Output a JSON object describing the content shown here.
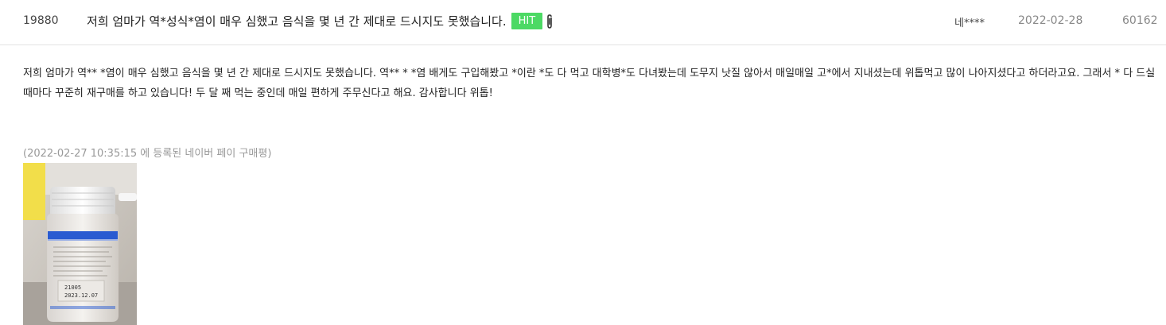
{
  "post": {
    "number": "19880",
    "title": "저희 엄마가 역*성식*염이 매우 심했고 음식을 몇 년 간 제대로 드시지도 못했습니다.",
    "badge": "HIT",
    "author": "네****",
    "date": "2022-02-28",
    "views": "60162",
    "attachment_icon": "paperclip-icon"
  },
  "body": {
    "paragraph": "저희 엄마가 역** *염이 매우 심했고 음식을 몇 년 간 제대로 드시지도 못했습니다. 역**  * *염 배게도 구입해봤고 *이란 *도 다 먹고 대학병*도 다녀봤는데 도무지 낫질 않아서 매일매일 고*에서 지내셨는데 위톱먹고 많이 나아지셨다고 하더라고요. 그래서 * 다 드실때마다 꾸준히 재구매를 하고 있습니다! 두 달 째 먹는 중인데 매일 편하게 주무신다고 해요. 감사합니다 위톱!",
    "registered_note": "(2022-02-27 10:35:15 에 등록된 네이버 페이 구매평)",
    "photo": {
      "label_lines": [
        "21005",
        "2023.12.07"
      ]
    }
  },
  "colors": {
    "badge_bg": "#4cd964",
    "divider": "#e3e3e3",
    "muted_text": "#999999"
  }
}
